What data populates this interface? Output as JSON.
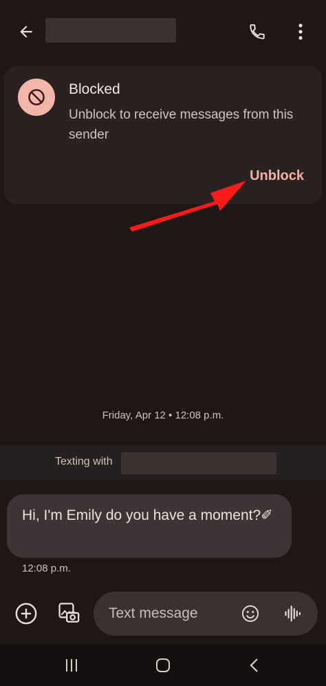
{
  "header": {
    "back_icon": "arrow-left-icon",
    "call_icon": "phone-icon",
    "more_icon": "more-vert-icon"
  },
  "blocked_card": {
    "icon": "block-icon",
    "title": "Blocked",
    "description": "Unblock to receive messages from this sender",
    "action_label": "Unblock",
    "accent_color": "#f5b1a6",
    "badge_color": "#f3b5a9"
  },
  "annotation": {
    "arrow_color": "#ff1a1a"
  },
  "conversation": {
    "date_stamp": "Friday, Apr 12 • 12:08 p.m.",
    "texting_with_label": "Texting with",
    "messages": [
      {
        "text": "Hi, I'm Emily do you have a moment?✐",
        "time": "12:08 p.m."
      }
    ]
  },
  "composer": {
    "placeholder": "Text message",
    "add_icon": "add-circle-icon",
    "gallery_icon": "gallery-camera-icon",
    "emoji_icon": "emoji-icon",
    "voice_icon": "voice-waveform-icon"
  },
  "navbar": {
    "items": [
      "recent-apps-icon",
      "home-icon",
      "back-icon"
    ]
  }
}
